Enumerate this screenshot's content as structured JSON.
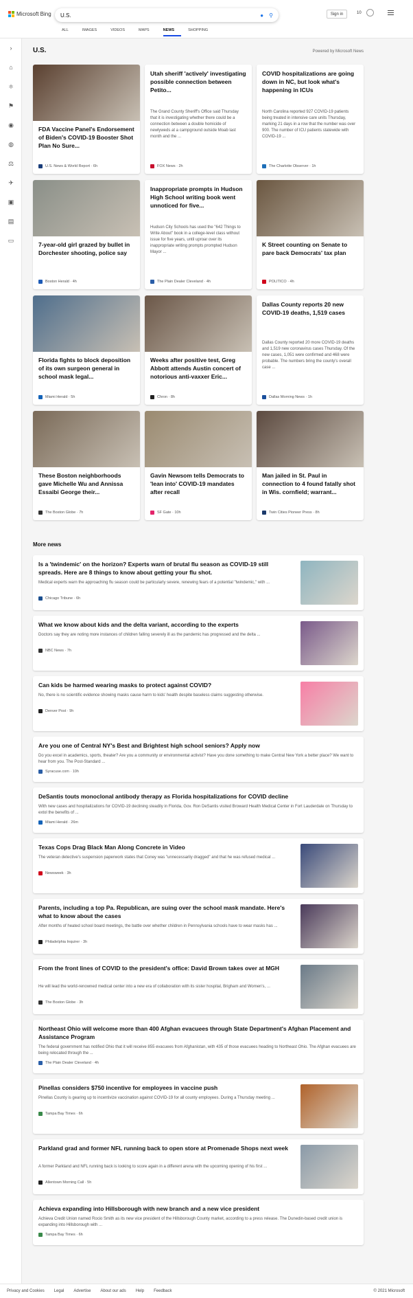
{
  "header": {
    "brand": "Microsoft Bing",
    "search_value": "U.S.",
    "signin": "Sign in",
    "points": "10"
  },
  "tabs": [
    "ALL",
    "IMAGES",
    "VIDEOS",
    "MAPS",
    "NEWS",
    "SHOPPING"
  ],
  "active_tab": "NEWS",
  "sidebar_icons": [
    "expand-icon",
    "home-icon",
    "science-icon",
    "flag-icon",
    "location-icon",
    "globe-icon",
    "business-icon",
    "tech-icon",
    "entertainment-icon",
    "politics-icon",
    "money-icon"
  ],
  "section": {
    "title": "U.S.",
    "powered": "Powered by Microsoft News"
  },
  "cards": [
    {
      "title": "FDA Vaccine Panel's Endorsement of Biden's COVID-19 Booster Shot Plan No Sure...",
      "source": "U.S. News & World Report",
      "time": "6h",
      "img": "#5a4030",
      "fav": "#1a3e7a"
    },
    {
      "title": "Utah sheriff 'actively' investigating possible connection between Petito...",
      "snippet": "The Grand County Sheriff's Office said Thursday that it is investigating whether there could be a connection between a double homicide of newlyweds at a campground outside Moab last month and the ...",
      "source": "FOX News",
      "time": "2h",
      "fav": "#c8102e"
    },
    {
      "title": "COVID hospitalizations are going down in NC, but look what's happening in ICUs",
      "snippet": "North Carolina reported 927 COVID-19 patients being treated in intensive care units Thursday, marking 21 days in a row that the number was over 900. The number of ICU patients statewide with COVID-19 ...",
      "source": "The Charlotte Observer",
      "time": "1h",
      "fav": "#1e6fb8"
    },
    {
      "title": "7-year-old girl grazed by bullet in Dorchester shooting, police say",
      "source": "Boston Herald",
      "time": "4h",
      "img": "#8a8f88",
      "fav": "#1d5bb6"
    },
    {
      "title": "Inappropriate prompts in Hudson High School writing book went unnoticed for five...",
      "snippet": "Hudson City Schools has used the \"642 Things to Write About\" book in a college-level class without issue for five years, until uproar over its inappropriate writing prompts prompted Hudson Mayor ...",
      "source": "The Plain Dealer Cleveland",
      "time": "4h",
      "fav": "#2a5ea8"
    },
    {
      "title": "K Street counting on Senate to pare back Democrats' tax plan",
      "source": "POLITICO",
      "time": "4h",
      "img": "#6a5640",
      "fav": "#d0021b"
    },
    {
      "title": "Florida fights to block deposition of its own surgeon general in school mask legal...",
      "source": "Miami Herald",
      "time": "5h",
      "img": "#4f6e8c",
      "fav": "#1463b8"
    },
    {
      "title": "Weeks after positive test, Greg Abbott attends Austin concert of notorious anti-vaxxer Eric...",
      "source": "Chron",
      "time": "8h",
      "img": "#6b5748",
      "fav": "#222222"
    },
    {
      "title": "Dallas County reports 20 new COVID-19 deaths, 1,519 cases",
      "snippet": "Dallas County reported 20 more COVID-19 deaths and 1,519 new coronavirus cases Thursday. Of the new cases, 1,051 were confirmed and 468 were probable. The numbers bring the county's overall case ...",
      "source": "Dallas Morning News",
      "time": "1h",
      "fav": "#1a4f9c"
    },
    {
      "title": "These Boston neighborhoods gave Michelle Wu and Annissa Essaibi George their...",
      "source": "The Boston Globe",
      "time": "7h",
      "img": "#7a6a58",
      "fav": "#333333"
    },
    {
      "title": "Gavin Newsom tells Democrats to 'lean into' COVID-19 mandates after recall",
      "source": "SF Gate",
      "time": "10h",
      "img": "#9a8a70",
      "fav": "#e3256b"
    },
    {
      "title": "Man jailed in St. Paul in connection to 4 found fatally shot in Wis. cornfield; warrant...",
      "source": "Twin Cities Pioneer Press",
      "time": "8h",
      "img": "#5c4a40",
      "fav": "#1b3a6b"
    }
  ],
  "more_title": "More news",
  "more": [
    {
      "title": "Is a 'twindemic' on the horizon? Experts warn of brutal flu season as COVID-19 still spreads. Here are 8 things to know about getting your flu shot.",
      "snippet": "Medical experts warn the approaching flu season could be particularly severe, renewing fears of a potential \"twindemic,\" with ...",
      "source": "Chicago Tribune",
      "time": "6h",
      "img": "#8fb5c0",
      "fav": "#1b4f8f"
    },
    {
      "title": "What we know about kids and the delta variant, according to the experts",
      "snippet": "Doctors say they are noting more instances of children falling severely ill as the pandemic has progressed and the delta ...",
      "source": "NBC News",
      "time": "7h",
      "img": "#7a5a8a",
      "fav": "#333333"
    },
    {
      "title": "Can kids be harmed wearing masks to protect against COVID?",
      "snippet": "No, there is no scientific evidence showing masks cause harm to kids' health despite baseless claims suggesting otherwise.",
      "source": "Denver Post",
      "time": "9h",
      "img": "#f77fa6",
      "fav": "#222222"
    },
    {
      "title": "Are you one of Central NY's Best and Brightest high school seniors? Apply now",
      "snippet": "Do you excel in academics, sports, theater? Are you a community or environmental activist? Have you done something to make Central New York a better place? We want to hear from you. The Post-Standard ...",
      "source": "Syracuse.com",
      "time": "10h",
      "fav": "#2b5ea5"
    },
    {
      "title": "DeSantis touts monoclonal antibody therapy as Florida hospitalizations for COVID decline",
      "snippet": "With new cases and hospitalizations for COVID-19 declining steadily in Florida, Gov. Ron DeSantis visited Broward Health Medical Center in Fort Lauderdale on Thursday to extol the benefits of ...",
      "source": "Miami Herald",
      "time": "26m",
      "fav": "#1463b8"
    },
    {
      "title": "Texas Cops Drag Black Man Along Concrete in Video",
      "snippet": "The veteran detective's suspension paperwork states that Coney was \"unnecessarily dragged\" and that he was refused medical ...",
      "source": "Newsweek",
      "time": "3h",
      "img": "#3a4a7a",
      "fav": "#d0021b"
    },
    {
      "title": "Parents, including a top Pa. Republican, are suing over the school mask mandate. Here's what to know about the cases",
      "snippet": "After months of heated school board meetings, the battle over whether children in Pennsylvania schools have to wear masks has ...",
      "source": "Philadelphia Inquirer",
      "time": "3h",
      "img": "#4a3a5a",
      "fav": "#222222"
    },
    {
      "title": "From the front lines of COVID to the president's office: David Brown takes over at MGH",
      "snippet": "He will lead the world-renowned medical center into a new era of collaboration with its sister hospital, Brigham and Women's, ...",
      "source": "The Boston Globe",
      "time": "3h",
      "img": "#6a7a88",
      "fav": "#333333"
    },
    {
      "title": "Northeast Ohio will welcome more than 400 Afghan evacuees through State Department's Afghan Placement and Assistance Program",
      "snippet": "The federal government has notified Ohio that it will receive 855 evacuees from Afghanistan, with 435 of those evacuees heading to Northeast Ohio. The Afghan evacuees are being relocated through the ...",
      "source": "The Plain Dealer Cleveland",
      "time": "4h",
      "fav": "#2a5ea8"
    },
    {
      "title": "Pinellas considers $750 incentive for employees in vaccine push",
      "snippet": "Pinellas County is gearing up to incentivize vaccination against COVID-19 for all county employees. During a Thursday meeting ...",
      "source": "Tampa Bay Times",
      "time": "6h",
      "img": "#b0622a",
      "fav": "#3a8a4a"
    },
    {
      "title": "Parkland grad and former NFL running back to open store at Promenade Shops next week",
      "snippet": "A former Parkland and NFL running back is looking to score again in a different arena with the upcoming opening of his first ...",
      "source": "Allentown Morning Call",
      "time": "5h",
      "img": "#8a9aa8",
      "fav": "#222222"
    },
    {
      "title": "Achieva expanding into Hillsborough with new branch and a new vice president",
      "snippet": "Achieva Credit Union named Rocio Smith as its new vice president of the Hillsborough County market, according to a press release. The Dunedin-based credit union is expanding into Hillsborough with ...",
      "source": "Tampa Bay Times",
      "time": "6h",
      "fav": "#3a8a4a"
    }
  ],
  "footer": {
    "links": [
      "Privacy and Cookies",
      "Legal",
      "Advertise",
      "About our ads",
      "Help",
      "Feedback"
    ],
    "copyright": "© 2021 Microsoft"
  }
}
